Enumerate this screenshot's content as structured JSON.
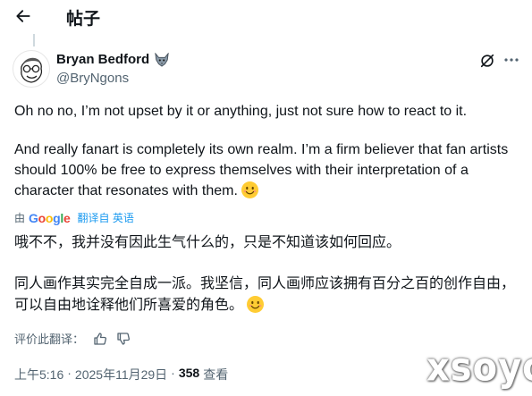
{
  "header": {
    "title": "帖子",
    "back_icon": "arrow-left-icon"
  },
  "author": {
    "display_name": "Bryan Bedford",
    "handle": "@BryNgons",
    "badge_icon": "wolf-icon",
    "avatar_icon": "sketched-face-avatar"
  },
  "actions": {
    "grok_icon": "grok-slash-icon",
    "more_icon": "more-dots-icon"
  },
  "tweet": {
    "paragraph1": "Oh no no, I’m not upset by it or anything, just not sure how to react to it.",
    "paragraph2": "And really fanart is completely its own realm. I’m a firm believer that fan artists should 100% be free to express themselves with their interpretation of a character that resonates with them.",
    "emoji": "smiling-face-emoji"
  },
  "translation_bar": {
    "by": "由",
    "provider": "Google",
    "translated_from": "翻译自 英语"
  },
  "translation": {
    "paragraph1": "哦不不，我并没有因此生气什么的，只是不知道该如何回应。",
    "paragraph2": "同人画作其实完全自成一派。我坚信，同人画师应该拥有百分之百的创作自由，可以自由地诠释他们所喜爱的角色。"
  },
  "rate": {
    "label": "评价此翻译：",
    "like_icon": "thumbs-up-icon",
    "dislike_icon": "thumbs-down-icon"
  },
  "meta": {
    "time": "上午5:16",
    "sep1": "·",
    "date": "2025年11月29日",
    "sep2": "·",
    "views_count": "358",
    "views_label": "查看"
  },
  "watermark": "xsoyo",
  "colors": {
    "text": "#0f1419",
    "secondary": "#536471",
    "accent": "#1d9bf0",
    "emoji": "#ffcc33"
  }
}
